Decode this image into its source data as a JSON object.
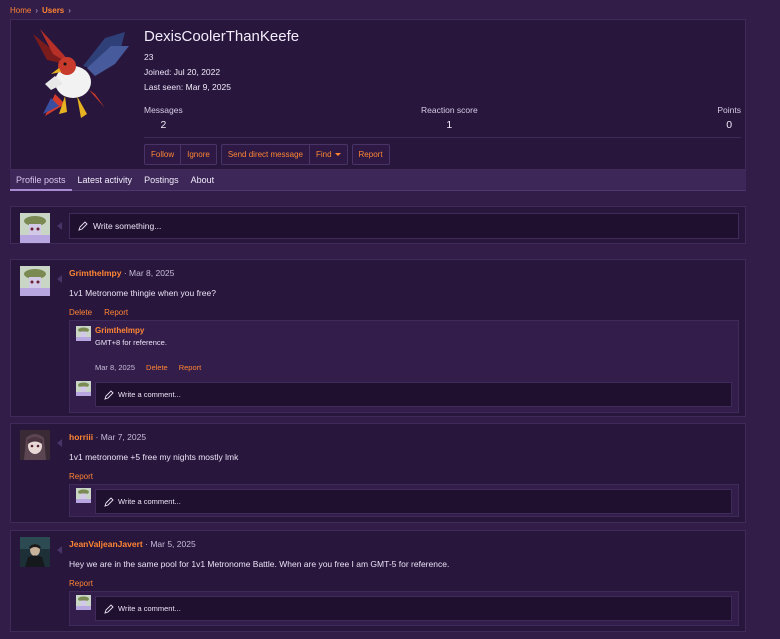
{
  "breadcrumb": {
    "home": "Home",
    "users": "Users",
    "sep": "›"
  },
  "profile": {
    "username": "DexisCoolerThanKeefe",
    "title": "23",
    "joined_label": "Joined:",
    "joined": "Jul 20, 2022",
    "last_seen_label": "Last seen:",
    "last_seen": "Mar 9, 2025",
    "stats": [
      {
        "label": "Messages",
        "value": "2"
      },
      {
        "label": "Reaction score",
        "value": "1"
      },
      {
        "label": "Points",
        "value": "0"
      }
    ],
    "actions": {
      "follow": "Follow",
      "ignore": "Ignore",
      "send_dm": "Send direct message",
      "find": "Find",
      "report": "Report"
    }
  },
  "tabs": [
    "Profile posts",
    "Latest activity",
    "Postings",
    "About"
  ],
  "composer": {
    "placeholder": "Write something..."
  },
  "posts": [
    {
      "author": "GrimtheImpy",
      "date": "Mar 8, 2025",
      "body": "1v1 Metronome thingie when you free?",
      "links": [
        "Delete",
        "Report"
      ],
      "comment": {
        "author": "GrimtheImpy",
        "body": "GMT+8 for reference.",
        "date": "Mar 8, 2025",
        "links": [
          "Delete",
          "Report"
        ]
      },
      "comment_placeholder": "Write a comment..."
    },
    {
      "author": "horriii",
      "date": "Mar 7, 2025",
      "body": "1v1 metronome +5 free my nights mostly lmk",
      "links": [
        "Report"
      ],
      "comment_placeholder": "Write a comment..."
    },
    {
      "author": "JeanValjeanJavert",
      "date": "Mar 5, 2025",
      "body": "Hey we are in the same pool for 1v1 Metronome Battle. When are you free I am GMT-5 for reference.",
      "links": [
        "Report"
      ],
      "comment_placeholder": "Write a comment..."
    }
  ],
  "date_sep": "·",
  "colors": {
    "background": "#321c48",
    "panel": "#28163d",
    "accent": "#ff8533",
    "tab_underline": "#a98bd4"
  },
  "icons": [
    "pencil-icon",
    "caret-down-icon",
    "breadcrumb-chevron-icon"
  ]
}
